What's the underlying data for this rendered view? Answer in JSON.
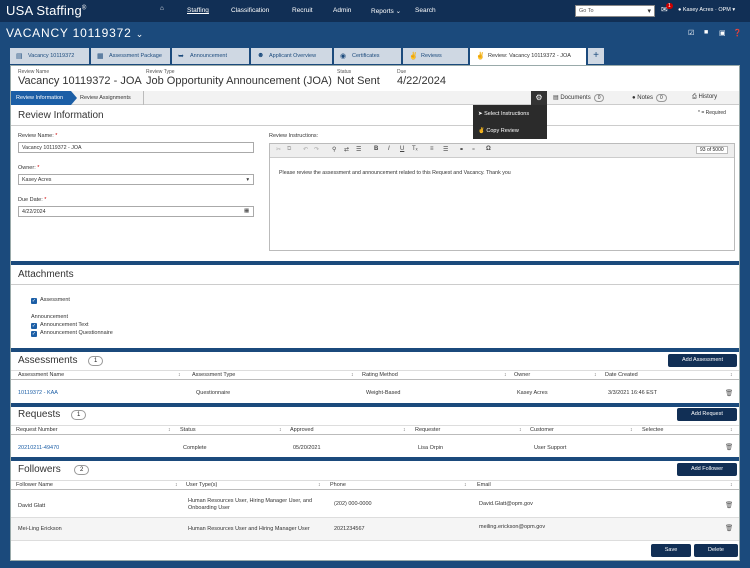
{
  "app": {
    "logo": "USA Staffing",
    "logo_mark": "®"
  },
  "nav": {
    "items": [
      "Staffing",
      "Classification",
      "Recruit",
      "Admin",
      "Reports",
      "Search"
    ],
    "goto_placeholder": "Go To",
    "notification_count": "1",
    "user": "Kasey Acres · OPM"
  },
  "vacancy": {
    "title": "VACANCY 10119372"
  },
  "tabs": [
    "Vacancy 10119372",
    "Assessment Package",
    "Announcement",
    "Applicant Overview",
    "Certificates",
    "Reviews",
    "Review: Vacancy 10119372 - JOA"
  ],
  "header": {
    "review_name_label": "Review Name",
    "review_name": "Vacancy 10119372 - JOA",
    "review_type_label": "Review Type",
    "review_type": "Job Opportunity Announcement (JOA)",
    "status_label": "Status",
    "status": "Not Sent",
    "due_label": "Due",
    "due": "4/22/2024"
  },
  "steps": {
    "step1": "Review Information",
    "step2": "Review Assignments"
  },
  "tools": {
    "documents": "Documents",
    "documents_count": "0",
    "notes": "Notes",
    "notes_count": "0",
    "history": "History"
  },
  "dropdown": {
    "item1": "Select Instructions",
    "item2": "Copy Review"
  },
  "review_info": {
    "title": "Review Information",
    "required_note": "* = Required",
    "name_label": "Review Name:",
    "name_value": "Vacancy 10119372 - JOA",
    "owner_label": "Owner:",
    "owner_value": "Kasey Acres",
    "due_label": "Due Date:",
    "due_value": "4/22/2024",
    "instructions_label": "Review Instructions:",
    "char_count": "93 of 5000",
    "instructions_text": "Please review the assessment and announcement related to this Request and Vacancy. Thank you"
  },
  "attachments": {
    "title": "Attachments",
    "assessment": "Assessment",
    "announcement_heading": "Announcement",
    "announcement_text": "Announcement Text",
    "announcement_questionnaire": "Announcement Questionnaire"
  },
  "assessments": {
    "title": "Assessments",
    "count": "1",
    "add_button": "Add Assessment",
    "columns": [
      "Assessment Name",
      "Assessment Type",
      "Rating Method",
      "Owner",
      "Date Created"
    ],
    "rows": [
      [
        "10119372 - KAA",
        "Questionnaire",
        "Weight-Based",
        "Kasey Acres",
        "3/3/2021 16:46 EST"
      ]
    ]
  },
  "requests": {
    "title": "Requests",
    "count": "1",
    "add_button": "Add Request",
    "columns": [
      "Request Number",
      "Status",
      "Approved",
      "Requester",
      "Customer",
      "Selectee"
    ],
    "rows": [
      [
        "20210211-49470",
        "Complete",
        "05/20/2021",
        "Lisa Orpin",
        "User Support",
        ""
      ]
    ]
  },
  "followers": {
    "title": "Followers",
    "count": "2",
    "add_button": "Add Follower",
    "columns": [
      "Follower Name",
      "User Type(s)",
      "Phone",
      "Email"
    ],
    "rows": [
      [
        "David Glatt",
        "Human Resources User, Hiring Manager User, and Onboarding User",
        "(202) 000-0000",
        "David.Glatt@opm.gov"
      ],
      [
        "Mei-Ling Erickson",
        "Human Resources User and Hiring Manager User",
        "2021234567",
        "meiling.erickson@opm.gov"
      ]
    ]
  },
  "footer": {
    "save": "Save",
    "delete": "Delete"
  }
}
